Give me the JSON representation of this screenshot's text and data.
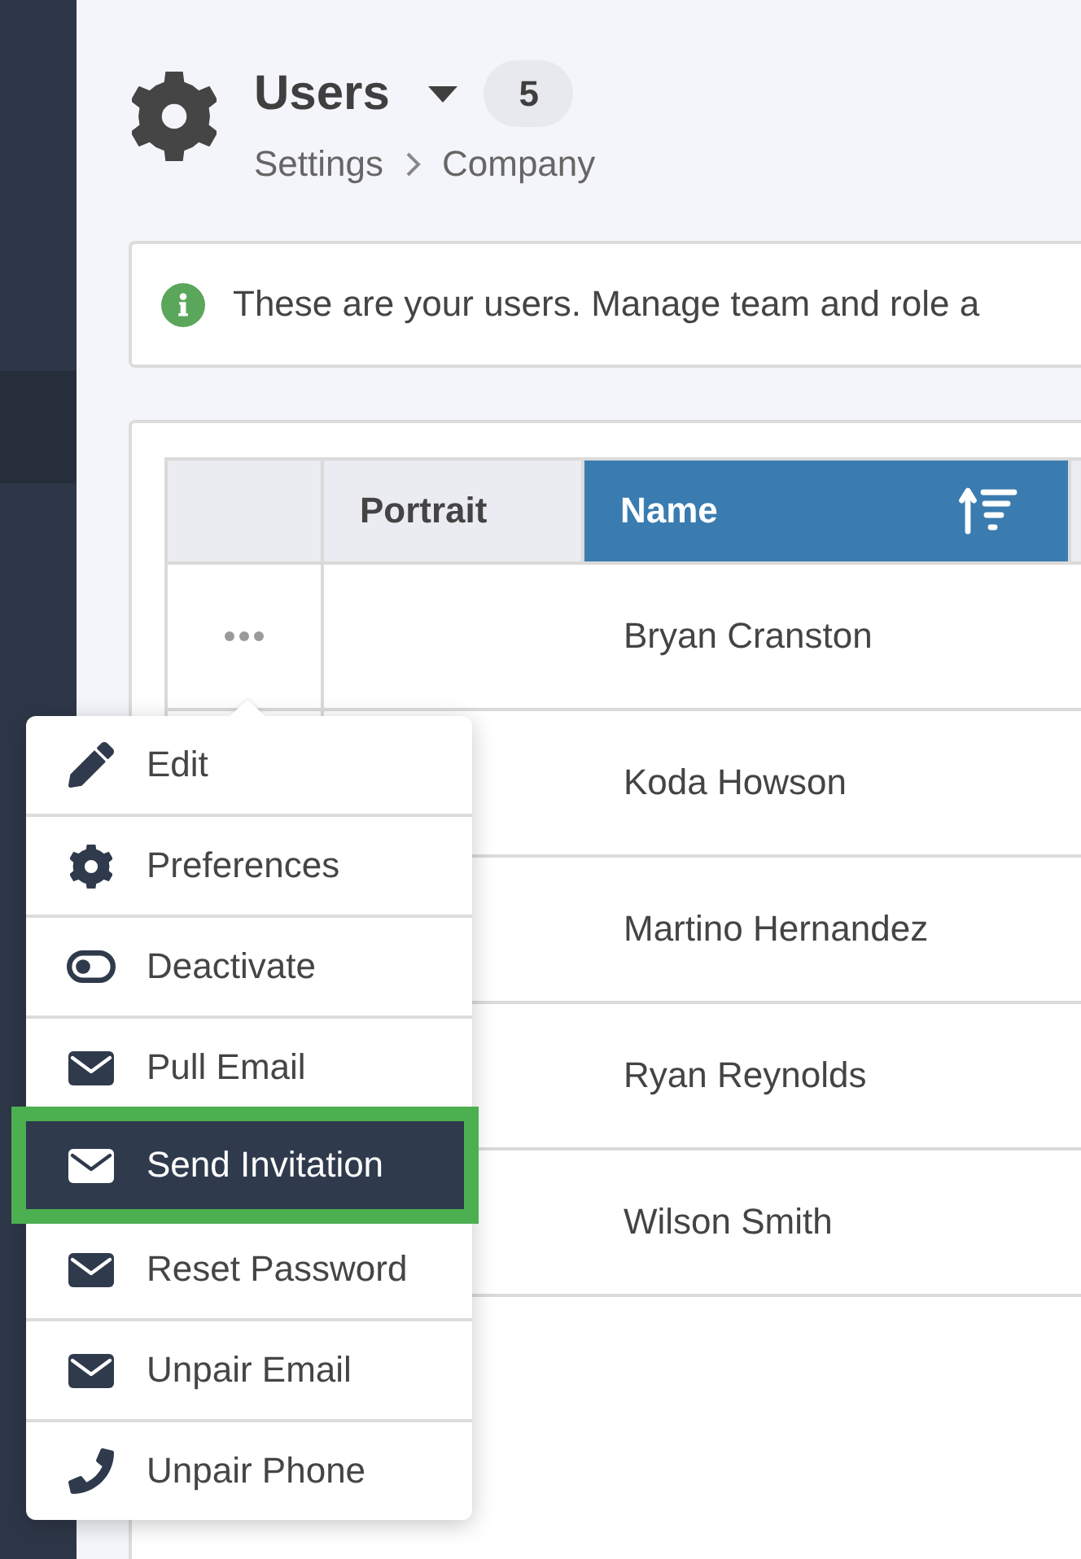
{
  "header": {
    "title": "Users",
    "count": "5",
    "breadcrumb": [
      "Settings",
      "Company"
    ]
  },
  "info_banner": {
    "message": "These are your users. Manage team and role a"
  },
  "table": {
    "columns": [
      {
        "label": "Portrait",
        "sorted": false
      },
      {
        "label": "Name",
        "sorted": true
      }
    ],
    "rows": [
      {
        "name": "Bryan Cranston",
        "menu_open": true
      },
      {
        "name": "Koda Howson",
        "menu_open": false
      },
      {
        "name": "Martino Hernandez",
        "menu_open": false
      },
      {
        "name": "Ryan Reynolds",
        "menu_open": false
      },
      {
        "name": "Wilson Smith",
        "menu_open": false
      }
    ]
  },
  "menu": {
    "items": [
      {
        "kind": "edit",
        "label": "Edit",
        "selected": false
      },
      {
        "kind": "settings",
        "label": "Preferences",
        "selected": false
      },
      {
        "kind": "toggle",
        "label": "Deactivate",
        "selected": false
      },
      {
        "kind": "email",
        "label": "Pull Email",
        "selected": false
      },
      {
        "kind": "email",
        "label": "Send Invitation",
        "selected": true
      },
      {
        "kind": "email",
        "label": "Reset Password",
        "selected": false
      },
      {
        "kind": "email",
        "label": "Unpair Email",
        "selected": false
      },
      {
        "kind": "phone",
        "label": "Unpair Phone",
        "selected": false
      }
    ]
  }
}
